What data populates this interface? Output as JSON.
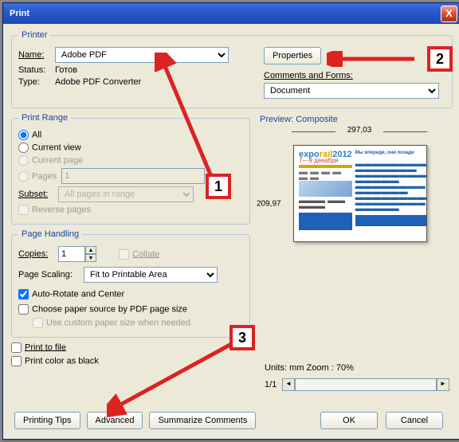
{
  "window": {
    "title": "Print",
    "close": "X"
  },
  "printer": {
    "legend": "Printer",
    "name_label": "Name:",
    "name_value": "Adobe PDF",
    "status_label": "Status:",
    "status_value": "Готов",
    "type_label": "Type:",
    "type_value": "Adobe PDF Converter",
    "properties_btn": "Properties",
    "comments_label": "Comments and Forms:",
    "comments_value": "Document"
  },
  "range": {
    "legend": "Print Range",
    "all": "All",
    "current_view": "Current view",
    "current_page": "Current page",
    "pages": "Pages",
    "pages_value": "1",
    "subset_label": "Subset:",
    "subset_value": "All pages in range",
    "reverse": "Reverse pages"
  },
  "page": {
    "legend": "Page Handling",
    "copies_label": "Copies:",
    "copies_value": "1",
    "collate": "Collate",
    "scaling_label": "Page Scaling:",
    "scaling_value": "Fit to Printable Area",
    "autorotate": "Auto-Rotate and Center",
    "choose_src": "Choose paper source by PDF page size",
    "custom_size": "Use custom paper size when needed"
  },
  "misc": {
    "print_to_file": "Print to file",
    "print_black": "Print color as black"
  },
  "preview": {
    "title": "Preview: Composite",
    "width": "297,03",
    "height": "209,97",
    "units": "Units: mm Zoom :   70%",
    "page": "1/1",
    "doc_title": "rail",
    "doc_year": "2012",
    "doc_sub": "7—9 декабря"
  },
  "buttons": {
    "tips": "Printing Tips",
    "advanced": "Advanced",
    "summarize": "Summarize Comments",
    "ok": "OK",
    "cancel": "Cancel"
  },
  "anno": {
    "n1": "1",
    "n2": "2",
    "n3": "3"
  }
}
